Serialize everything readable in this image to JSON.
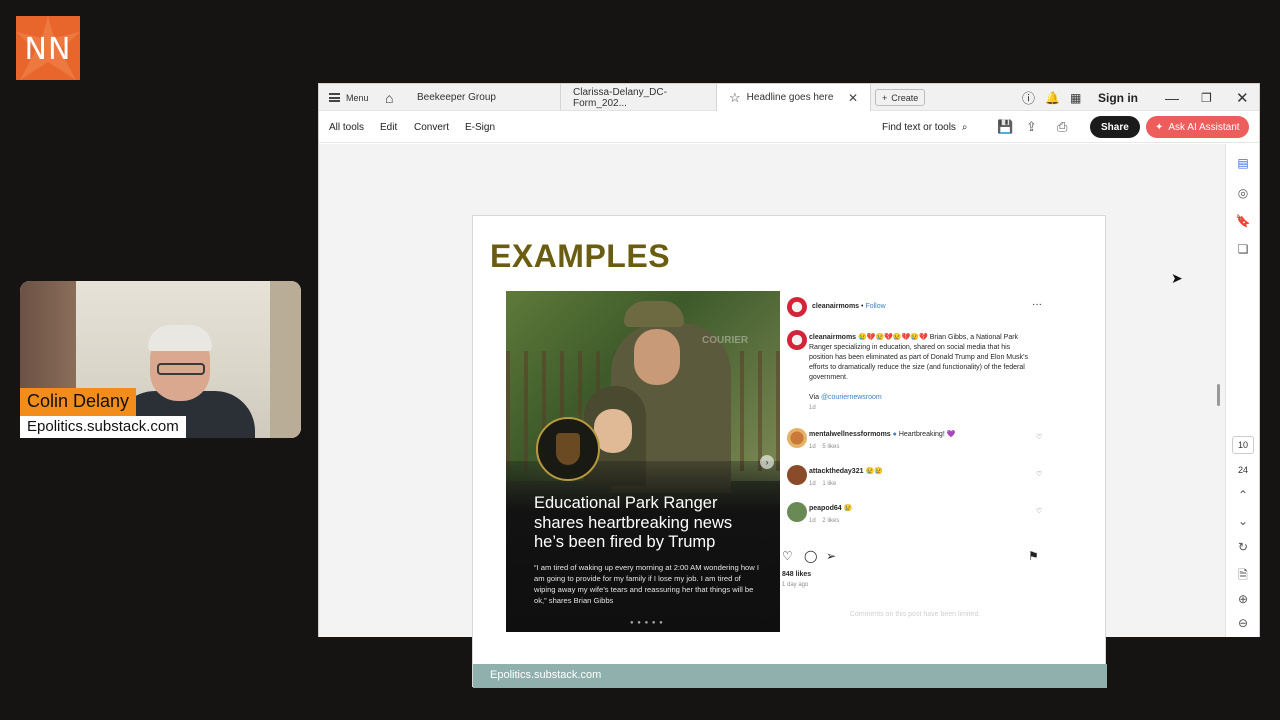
{
  "logo": {
    "text": "NN"
  },
  "presenter": {
    "name": "Colin Delany",
    "url": "Epolitics.substack.com"
  },
  "tabbar": {
    "menu_label": "Menu",
    "tabs": [
      {
        "label": "Beekeeper Group"
      },
      {
        "label": "Clarissa-Delany_DC-Form_202..."
      },
      {
        "label": "Headline goes here"
      }
    ],
    "create_label": "Create",
    "sign_in": "Sign in"
  },
  "toolbar": {
    "all_tools": "All tools",
    "edit": "Edit",
    "convert": "Convert",
    "esign": "E-Sign",
    "find": "Find text or tools",
    "share": "Share",
    "ai_assistant": "Ask AI Assistant"
  },
  "rail": {
    "page_current": "10",
    "page_total": "24"
  },
  "slide": {
    "title": "EXAMPLES",
    "footer": "Epolitics.substack.com",
    "post": {
      "watermark": "COURIER",
      "headline": "Educational Park Ranger shares heartbreaking news he’s been fired by Trump",
      "quote": "“I am tired of waking up every morning at 2:00 AM wondering how I am going to provide for my family if I lose my job. I am tired of wiping away my wife’s tears and reassuring her that things will be ok,” shares Brian Gibbs"
    },
    "instagram": {
      "account": "cleanairmoms",
      "follow": "Follow",
      "more": "···",
      "caption_user": "cleanairmoms",
      "caption_emoji": "😢💔😢💔😢💔😢💔",
      "caption_text": "Brian Gibbs, a National Park Ranger specializing in education, shared on social media that his position has been eliminated as part of Donald Trump and Elon Musk’s efforts to dramatically reduce the size (and functionality) of the federal government.",
      "via": "Via ",
      "via_handle": "@couriernewsroom",
      "caption_time": "1d",
      "comments": [
        {
          "user": "mentalwellnessformoms",
          "text": "Heartbreaking! 💜",
          "time": "1d",
          "likes": "5 likes"
        },
        {
          "user": "attacktheday321",
          "text": "😢😢",
          "time": "1d",
          "likes": "1 like"
        },
        {
          "user": "peapod64",
          "text": "😢",
          "time": "1d",
          "likes": "2 likes"
        }
      ],
      "likes": "848 likes",
      "posted": "1 day ago",
      "limited": "Comments on this post have been limited."
    }
  }
}
